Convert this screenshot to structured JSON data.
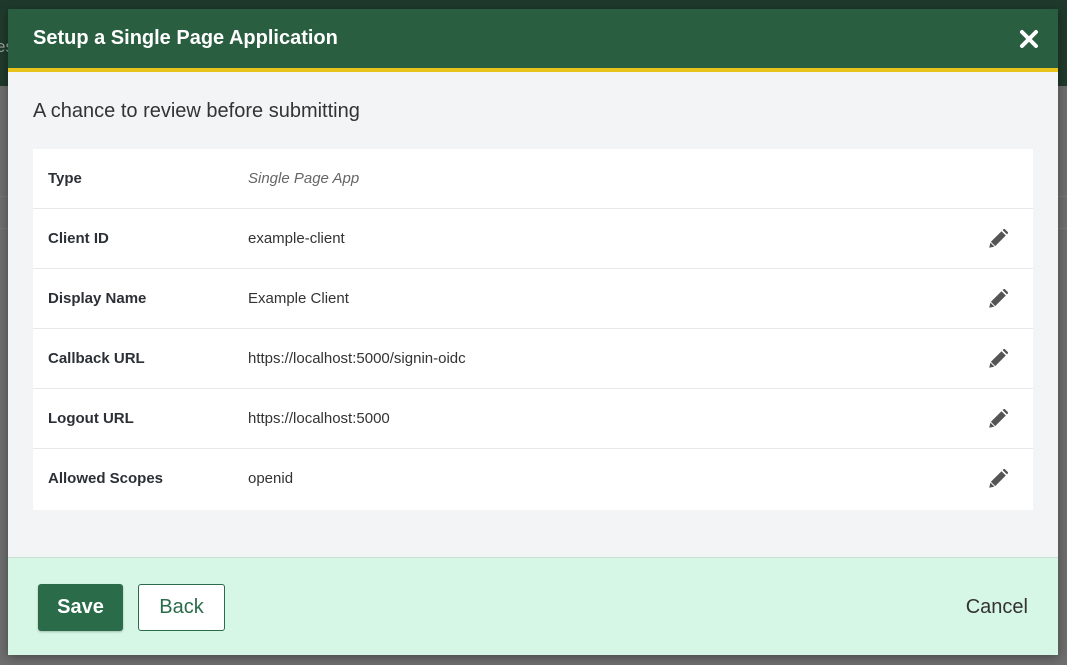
{
  "modal": {
    "title": "Setup a Single Page Application",
    "close_icon": "close-icon",
    "subtitle": "A chance to review before submitting"
  },
  "background": {
    "peek_text": "es"
  },
  "review": {
    "rows": [
      {
        "label": "Type",
        "value": "Single Page App",
        "editable": false
      },
      {
        "label": "Client ID",
        "value": "example-client",
        "editable": true
      },
      {
        "label": "Display Name",
        "value": "Example Client",
        "editable": true
      },
      {
        "label": "Callback URL",
        "value": "https://localhost:5000/signin-oidc",
        "editable": true
      },
      {
        "label": "Logout URL",
        "value": "https://localhost:5000",
        "editable": true
      },
      {
        "label": "Allowed Scopes",
        "value": "openid",
        "editable": true
      }
    ],
    "edit_icon": "pencil-icon"
  },
  "footer": {
    "save_label": "Save",
    "back_label": "Back",
    "cancel_label": "Cancel"
  },
  "colors": {
    "header_bg": "#2a5e40",
    "header_accent": "#e8c31c",
    "footer_bg": "#d7f7e6",
    "primary": "#2a6b4a"
  }
}
